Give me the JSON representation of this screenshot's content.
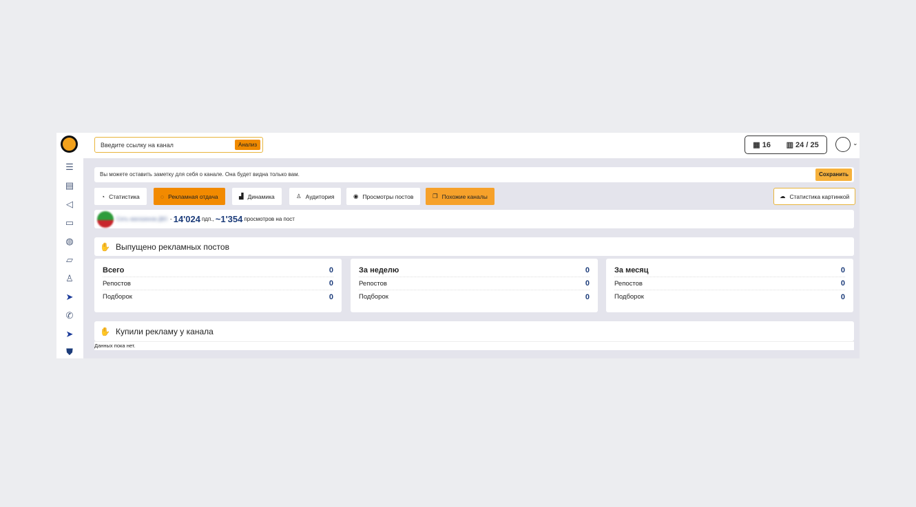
{
  "header": {
    "search_placeholder": "Введите ссылку на канал",
    "analyze": "Анализ",
    "calendar_count": "16",
    "limits": "24 / 25"
  },
  "note": {
    "text": "Вы можете оставить заметку для себя о канале. Она будет видна только вам.",
    "save": "Сохранить"
  },
  "tabs": [
    {
      "label": "Статистика"
    },
    {
      "label": "Рекламная отдача"
    },
    {
      "label": "Динамика"
    },
    {
      "label": "Аудитория"
    },
    {
      "label": "Просмотры постов"
    },
    {
      "label": "Похожие каналы"
    }
  ],
  "image_stats": "Статистика картинкой",
  "channel": {
    "name": "Сеть магазинов ДЮ",
    "subscribers": "14'024",
    "subs_suffix": "пдп.,",
    "views": "~1'354",
    "views_suffix": "просмотров на пост"
  },
  "section1": {
    "title": "Выпущено рекламных постов",
    "cards": [
      {
        "title": "Всего",
        "total": "0",
        "rows": [
          {
            "label": "Репостов",
            "value": "0"
          },
          {
            "label": "Подборок",
            "value": "0"
          }
        ]
      },
      {
        "title": "За неделю",
        "total": "0",
        "rows": [
          {
            "label": "Репостов",
            "value": "0"
          },
          {
            "label": "Подборок",
            "value": "0"
          }
        ]
      },
      {
        "title": "За месяц",
        "total": "0",
        "rows": [
          {
            "label": "Репостов",
            "value": "0"
          },
          {
            "label": "Подборок",
            "value": "0"
          }
        ]
      }
    ]
  },
  "section2": {
    "title": "Купили рекламу у канала",
    "empty": "Данных пока нет."
  },
  "colors": {
    "accent": "#f28a00",
    "number": "#1c3c7a"
  }
}
